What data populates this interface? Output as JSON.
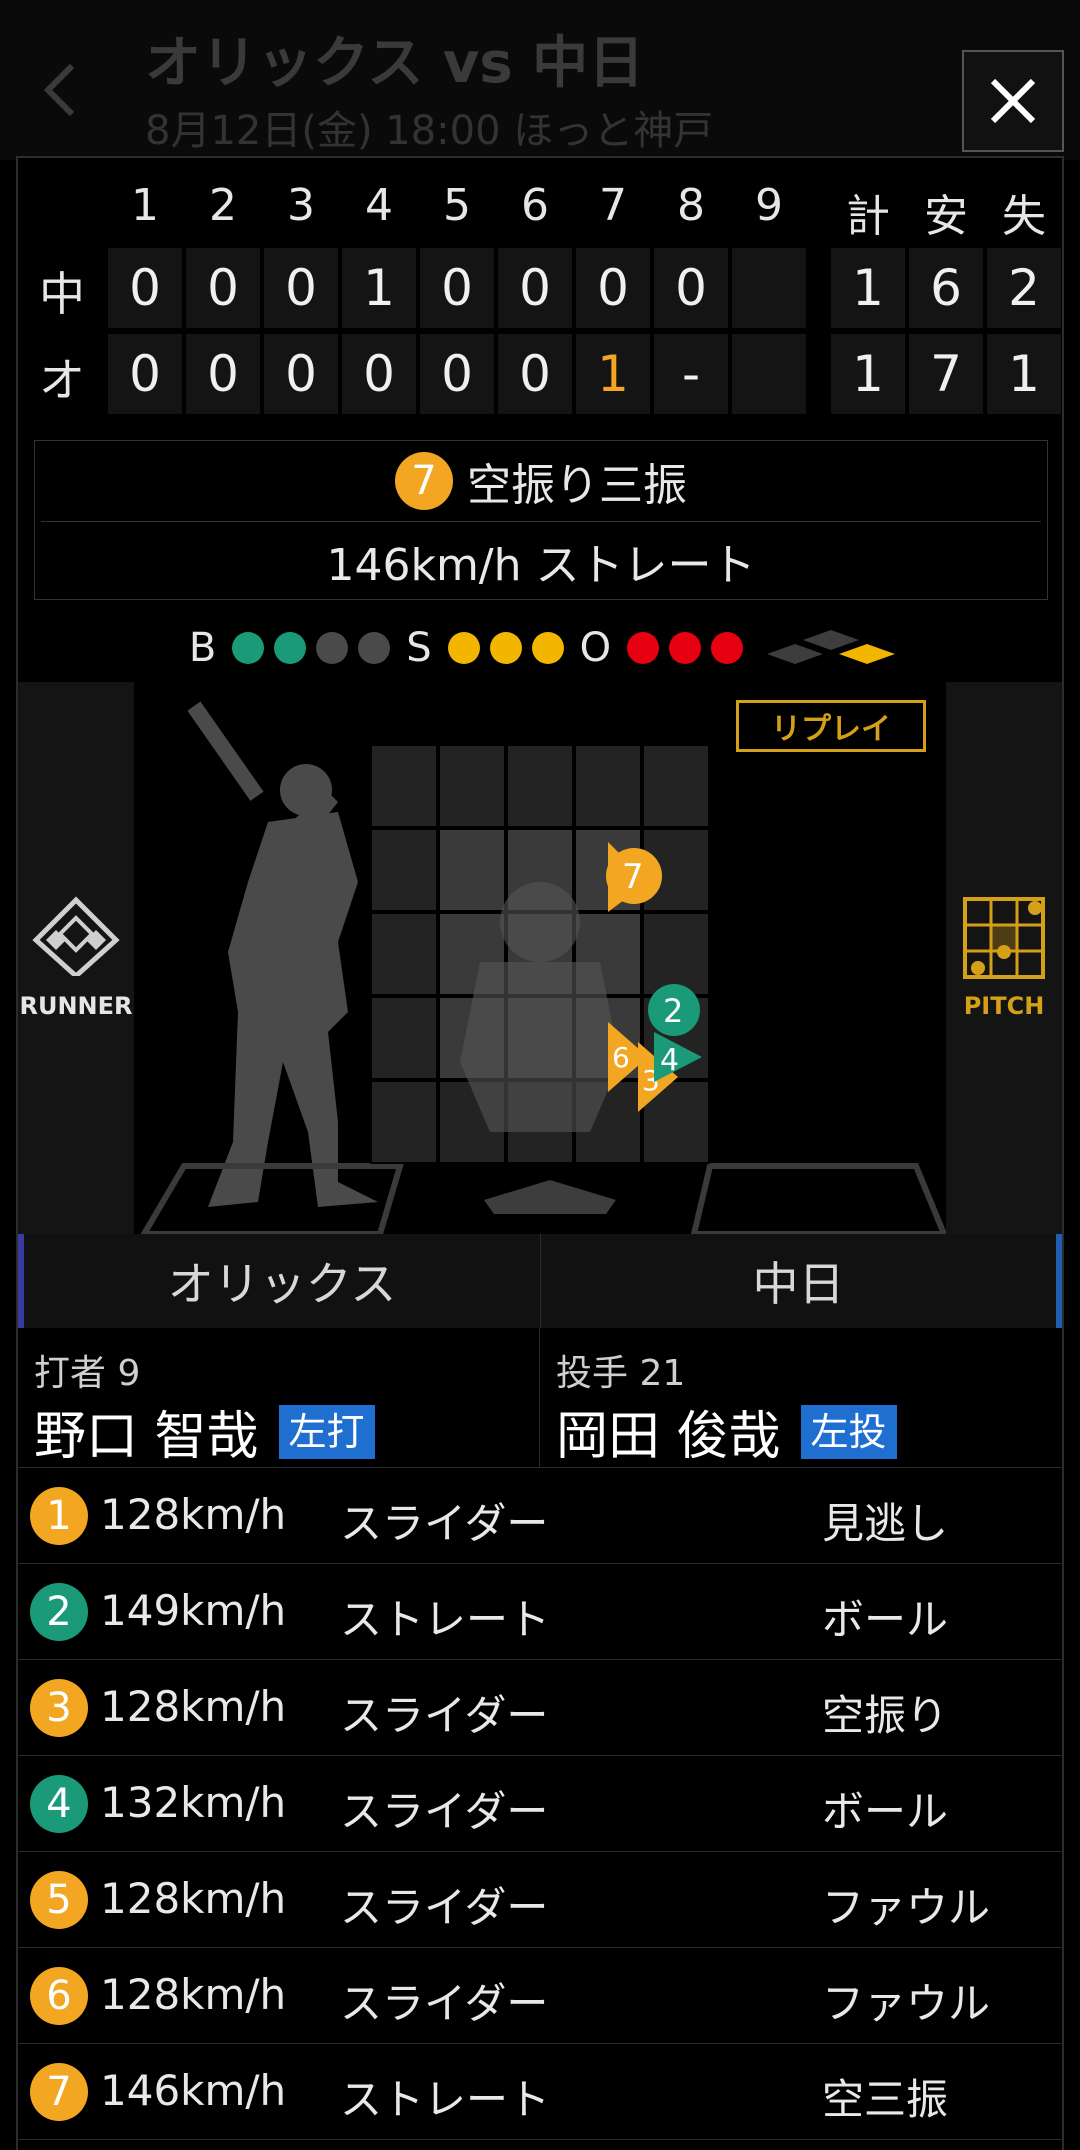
{
  "header": {
    "title": "オリックス vs 中日",
    "subtitle": "8月12日(金) 18:00 ほっと神戸",
    "close_label": "×"
  },
  "scoreboard": {
    "innings": [
      "1",
      "2",
      "3",
      "4",
      "5",
      "6",
      "7",
      "8",
      "9"
    ],
    "totals_headers": [
      "計",
      "安",
      "失"
    ],
    "rows": [
      {
        "team": "中",
        "scores": [
          "0",
          "0",
          "0",
          "1",
          "0",
          "0",
          "0",
          "0",
          ""
        ],
        "totals": [
          "1",
          "6",
          "2"
        ]
      },
      {
        "team": "オ",
        "scores": [
          "0",
          "0",
          "0",
          "0",
          "0",
          "0",
          "1",
          "-",
          ""
        ],
        "totals": [
          "1",
          "7",
          "1"
        ]
      }
    ]
  },
  "result": {
    "pitch_number": "7",
    "outcome": "空振り三振",
    "pitch_info": "146km/h ストレート"
  },
  "count": {
    "ball_label": "B",
    "balls": 2,
    "strike_label": "S",
    "strikes": 3,
    "out_label": "O",
    "outs": 3
  },
  "field": {
    "replay_label": "リプレイ",
    "runner_label": "RUNNER",
    "pitch_label": "PITCH"
  },
  "teams": {
    "home": "オリックス",
    "away": "中日"
  },
  "batter": {
    "role": "打者 9",
    "name": "野口 智哉",
    "hand": "左打"
  },
  "pitcher": {
    "role": "投手 21",
    "name": "岡田 俊哉",
    "hand": "左投"
  },
  "pitches": [
    {
      "num": "1",
      "color": "yellow",
      "speed": "128km/h",
      "type": "スライダー",
      "result": "見逃し"
    },
    {
      "num": "2",
      "color": "green",
      "speed": "149km/h",
      "type": "ストレート",
      "result": "ボール"
    },
    {
      "num": "3",
      "color": "yellow",
      "speed": "128km/h",
      "type": "スライダー",
      "result": "空振り"
    },
    {
      "num": "4",
      "color": "green",
      "speed": "132km/h",
      "type": "スライダー",
      "result": "ボール"
    },
    {
      "num": "5",
      "color": "yellow",
      "speed": "128km/h",
      "type": "スライダー",
      "result": "ファウル"
    },
    {
      "num": "6",
      "color": "yellow",
      "speed": "128km/h",
      "type": "スライダー",
      "result": "ファウル"
    },
    {
      "num": "7",
      "color": "yellow",
      "speed": "146km/h",
      "type": "ストレート",
      "result": "空三振"
    }
  ],
  "colors": {
    "strike": "#f2a622",
    "ball": "#1a9a78",
    "out": "#e60012",
    "hand_badge": "#1f6fd1",
    "replay": "#d4a017"
  }
}
